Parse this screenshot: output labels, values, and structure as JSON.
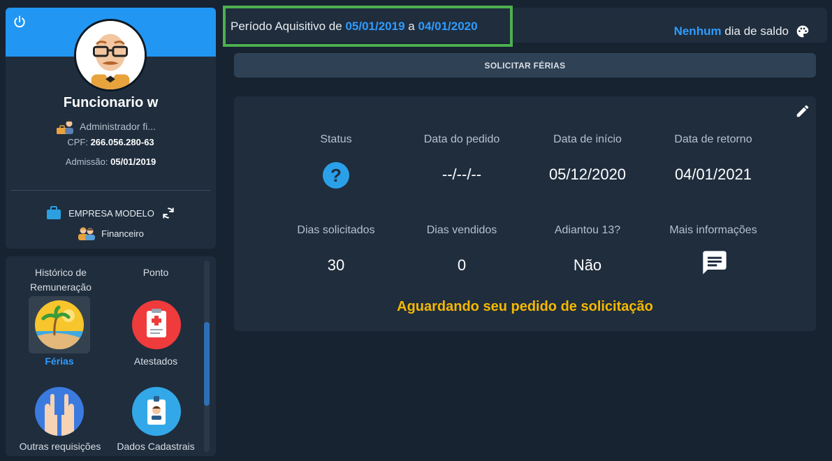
{
  "profile": {
    "name": "Funcionario w",
    "role": "Administrador fi...",
    "cpf_label": "CPF:",
    "cpf_value": "266.056.280-63",
    "admission_label": "Admissão:",
    "admission_value": "05/01/2019",
    "company": "EMPRESA MODELO",
    "department": "Financeiro"
  },
  "menu": {
    "items": [
      {
        "label": "Histórico de Remuneração",
        "icon": "receipt-icon"
      },
      {
        "label": "Ponto",
        "icon": "clock-icon"
      },
      {
        "label": "Férias",
        "icon": "beach-icon",
        "active": true
      },
      {
        "label": "Atestados",
        "icon": "medical-clipboard-icon"
      },
      {
        "label": "Outras requisições",
        "icon": "raised-hands-icon"
      },
      {
        "label": "Dados Cadastrais",
        "icon": "id-badge-icon"
      }
    ]
  },
  "header": {
    "period_prefix": "Período Aquisitivo de",
    "period_start": "05/01/2019",
    "period_sep": "a",
    "period_end": "04/01/2020",
    "saldo_highlight": "Nenhum",
    "saldo_rest": "dia de saldo"
  },
  "request_button_label": "SOLICITAR FÉRIAS",
  "details": {
    "labels": {
      "status": "Status",
      "request_date": "Data do pedido",
      "start_date": "Data de início",
      "return_date": "Data de retorno",
      "days_requested": "Dias solicitados",
      "days_sold": "Dias vendidos",
      "advance_13": "Adiantou 13?",
      "more_info": "Mais informações"
    },
    "values": {
      "request_date": "--/--/--",
      "start_date": "05/12/2020",
      "return_date": "04/01/2021",
      "days_requested": "30",
      "days_sold": "0",
      "advance_13": "Não"
    },
    "waiting_message": "Aguardando seu pedido de solicitação"
  },
  "colors": {
    "accent": "#2196f3",
    "highlight_text": "#2f9bff",
    "warning": "#f5b800",
    "focus_border": "#4caf50"
  }
}
